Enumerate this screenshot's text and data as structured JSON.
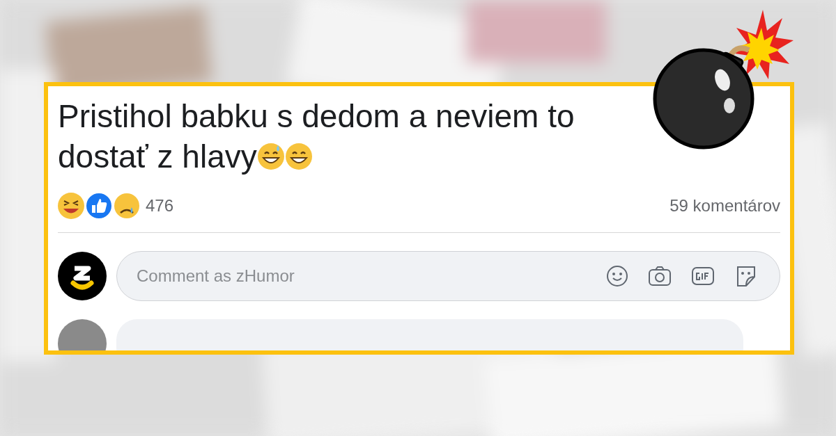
{
  "post": {
    "title_lines": [
      "Pristihol babku s dedom a neviem to",
      "dostať z hlavy"
    ],
    "reaction_count": "476",
    "comment_count": "59 komentárov",
    "composer": {
      "placeholder": "Comment as zHumor"
    }
  }
}
